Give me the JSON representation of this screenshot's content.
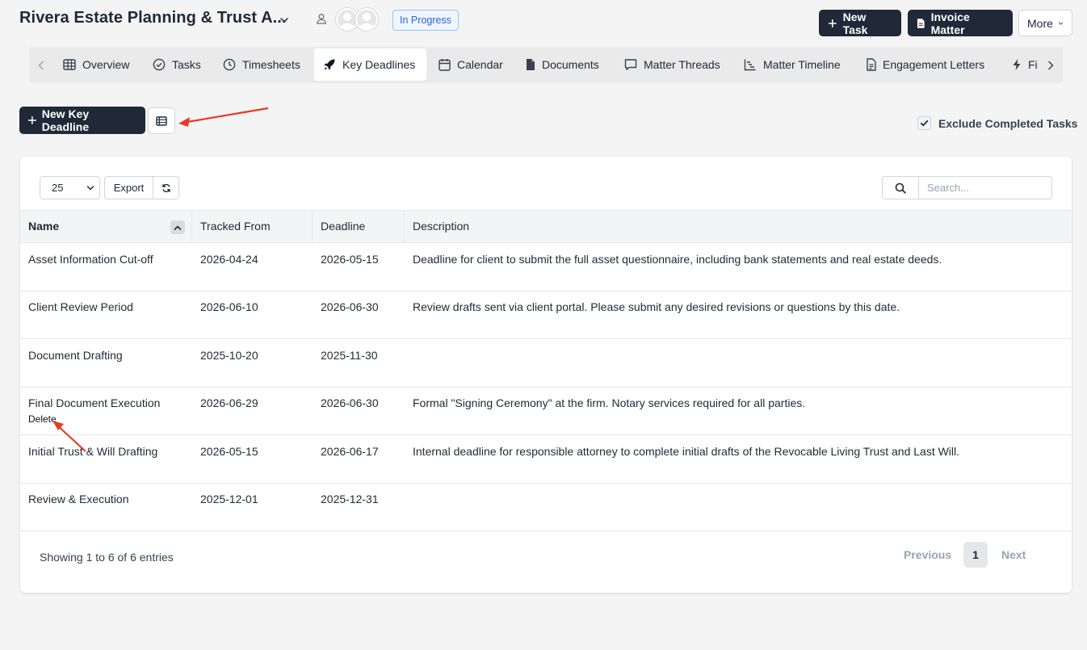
{
  "header": {
    "title": "Rivera Estate Planning & Trust A...",
    "status": "In Progress",
    "new_task_label": "New Task",
    "invoice_label": "Invoice Matter",
    "more_label": "More"
  },
  "tabs": [
    {
      "label": "Overview",
      "icon": "table-icon"
    },
    {
      "label": "Tasks",
      "icon": "check-circle-icon"
    },
    {
      "label": "Timesheets",
      "icon": "clock-icon"
    },
    {
      "label": "Key Deadlines",
      "icon": "rocket-icon",
      "active": true
    },
    {
      "label": "Calendar",
      "icon": "calendar-icon"
    },
    {
      "label": "Documents",
      "icon": "file-icon"
    },
    {
      "label": "Matter Threads",
      "icon": "message-icon"
    },
    {
      "label": "Matter Timeline",
      "icon": "timeline-icon"
    },
    {
      "label": "Engagement Letters",
      "icon": "file-text-icon"
    },
    {
      "label": "Fi",
      "icon": "bolt-icon"
    }
  ],
  "toolbar": {
    "new_deadline_label": "New Key Deadline",
    "exclude_label": "Exclude Completed Tasks",
    "exclude_checked": true
  },
  "table_controls": {
    "page_size": "25",
    "export_label": "Export",
    "search_placeholder": "Search..."
  },
  "table": {
    "columns": [
      "Name",
      "Tracked From",
      "Deadline",
      "Description"
    ],
    "rows": [
      {
        "name": "Asset Information Cut-off",
        "tracked_from": "2026-04-24",
        "deadline": "2026-05-15",
        "description": "Deadline for client to submit the full asset questionnaire, including bank statements and real estate deeds."
      },
      {
        "name": "Client Review Period",
        "tracked_from": "2026-06-10",
        "deadline": "2026-06-30",
        "description": "Review drafts sent via client portal. Please submit any desired revisions or questions by this date."
      },
      {
        "name": "Document Drafting",
        "tracked_from": "2025-10-20",
        "deadline": "2025-11-30",
        "description": ""
      },
      {
        "name": "Final Document Execution",
        "tracked_from": "2026-06-29",
        "deadline": "2026-06-30",
        "description": "Formal \"Signing Ceremony\" at the firm. Notary services required for all parties.",
        "action": "Delete"
      },
      {
        "name": "Initial Trust & Will Drafting",
        "tracked_from": "2026-05-15",
        "deadline": "2026-06-17",
        "description": "Internal deadline for responsible attorney to complete initial drafts of the Revocable Living Trust and Last Will."
      },
      {
        "name": "Review & Execution",
        "tracked_from": "2025-12-01",
        "deadline": "2025-12-31",
        "description": ""
      }
    ]
  },
  "footer": {
    "showing": "Showing 1 to 6 of 6 entries",
    "previous": "Previous",
    "page": "1",
    "next": "Next"
  },
  "colors": {
    "primary_dark": "#1f2937",
    "status_blue": "#2563eb",
    "annotation_red": "#e53b25"
  }
}
